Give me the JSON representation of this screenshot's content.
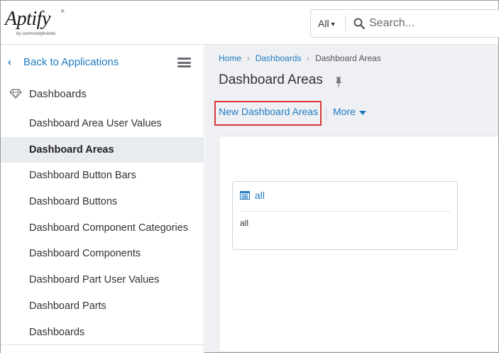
{
  "header": {
    "logo_text": "Aptify",
    "logo_sub": "by communitybrands",
    "logo_tm": "®",
    "search": {
      "scope": "All",
      "placeholder": "Search..."
    }
  },
  "sidebar": {
    "back_label": "Back to Applications",
    "section_label": "Dashboards",
    "items": [
      {
        "label": "Dashboard Area User Values"
      },
      {
        "label": "Dashboard Areas"
      },
      {
        "label": "Dashboard Button Bars"
      },
      {
        "label": "Dashboard Buttons"
      },
      {
        "label": "Dashboard Component Categories"
      },
      {
        "label": "Dashboard Components"
      },
      {
        "label": "Dashboard Part User Values"
      },
      {
        "label": "Dashboard Parts"
      },
      {
        "label": "Dashboards"
      }
    ],
    "active_item": "Dashboard Areas"
  },
  "main": {
    "breadcrumb": [
      "Home",
      "Dashboards",
      "Dashboard Areas"
    ],
    "title": "Dashboard Areas",
    "actions": {
      "new_label": "New Dashboard Areas",
      "more_label": "More"
    },
    "card": {
      "title": "all",
      "body": "all"
    }
  },
  "colors": {
    "accent": "#1f7bc2",
    "highlight": "#d9383b",
    "main_bg": "#eef0f3",
    "active_bg": "#e8ebef"
  }
}
